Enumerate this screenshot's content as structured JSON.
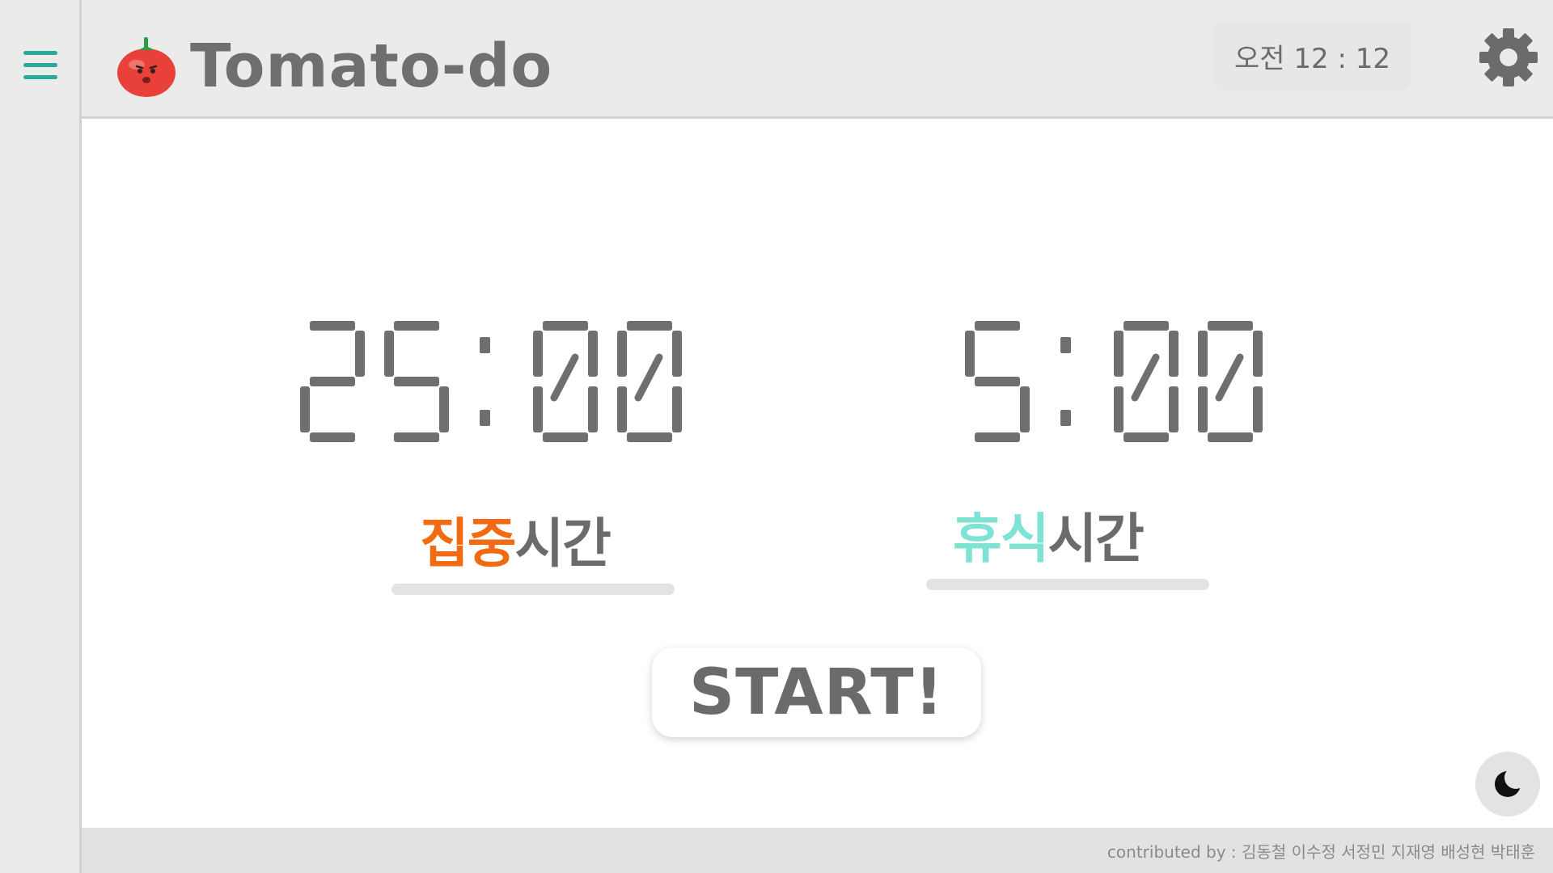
{
  "app": {
    "title": "Tomato-do",
    "menu_icon": "hamburger-menu-icon",
    "logo_icon": "tomato-icon"
  },
  "header": {
    "clock_text": "오전 12 : 12",
    "settings_icon": "gear-icon"
  },
  "timers": {
    "focus": {
      "display": "25 : 00",
      "minutes": "25",
      "seconds": "00",
      "label_accent": "집중",
      "label_rest": "시간"
    },
    "rest": {
      "display": "5 : 00",
      "minutes": "5",
      "seconds": "00",
      "label_accent": "휴식",
      "label_rest": "시간"
    }
  },
  "actions": {
    "start_label": "START!",
    "theme_icon": "moon-icon"
  },
  "footer": {
    "credits": "contributed by : 김동철 이수정 서정민 지재영 배성현 박태훈"
  },
  "colors": {
    "accent_focus": "#f26a12",
    "accent_rest": "#7fe3d3",
    "menu_teal": "#2aa89a",
    "text_gray": "#6b6b6b",
    "digit_gray": "#6f6f6f"
  }
}
